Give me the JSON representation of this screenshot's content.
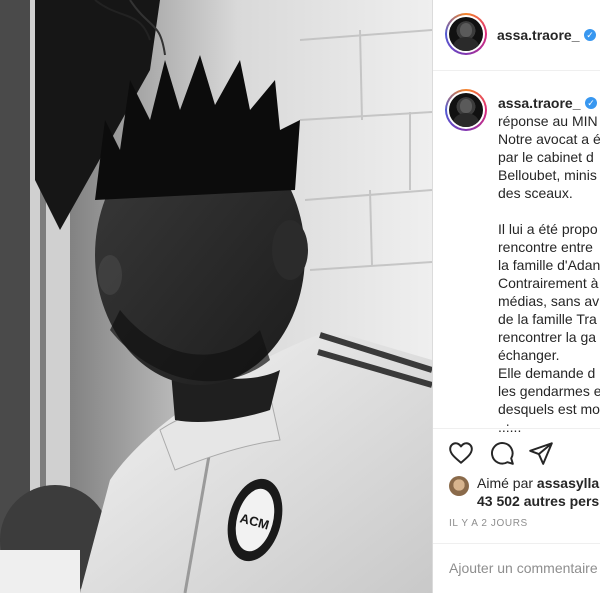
{
  "post": {
    "image_alt": "Black and white photo of a young man in an AC Milan track jacket",
    "jersey_badge_text": "ACM"
  },
  "header": {
    "username": "assa.traore_",
    "verified": true,
    "avatar_icon": "profile-avatar-icon"
  },
  "caption": {
    "username": "assa.traore_",
    "lines": [
      "réponse au MIN",
      "Notre avocat a é",
      "par le cabinet d",
      "Belloubet, minis",
      "des sceaux.",
      "",
      "Il lui a été propo",
      "rencontre entre",
      "la famille d'Adan",
      "Contrairement à",
      "médias, sans av",
      "de la famille Tra",
      "rencontrer la ga",
      "échanger.",
      "Elle demande d",
      "les gendarmes e",
      "desquels est mo",
      "..:..."
    ]
  },
  "actions": {
    "like_icon": "heart-icon",
    "comment_icon": "comment-icon",
    "share_icon": "share-icon"
  },
  "likes": {
    "prefix": "Aimé par ",
    "user": "assasylla",
    "count_text": "43 502 autres pers"
  },
  "timestamp": "IL Y A 2 JOURS",
  "comment": {
    "placeholder": "Ajouter un commentaire"
  },
  "colors": {
    "verified": "#3897f0",
    "text": "#262626",
    "muted": "#8e8e8e",
    "separator": "#efefef"
  }
}
